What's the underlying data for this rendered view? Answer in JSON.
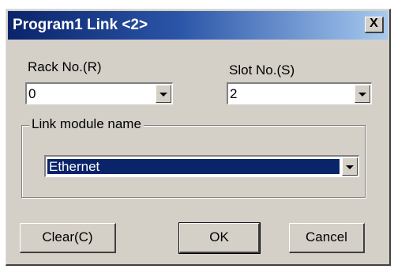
{
  "window": {
    "title": "Program1  Link <2>",
    "close_label": "X"
  },
  "rack": {
    "label": "Rack No.(R)",
    "value": "0"
  },
  "slot": {
    "label": "Slot No.(S)",
    "value": "2"
  },
  "link_module": {
    "group_label": "Link module name",
    "value": "Ethernet"
  },
  "buttons": {
    "clear": "Clear(C)",
    "ok": "OK",
    "cancel": "Cancel"
  },
  "colors": {
    "titlebar_start": "#0a246a",
    "dialog_face": "#d4d0c8",
    "selection": "#0a246a"
  }
}
